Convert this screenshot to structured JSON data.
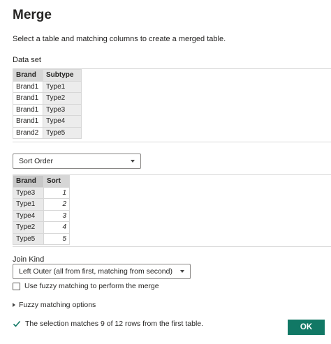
{
  "dialog": {
    "title": "Merge",
    "subtitle": "Select a table and matching columns to create a merged table."
  },
  "dataset": {
    "label": "Data set",
    "headers": [
      "Brand",
      "Subtype"
    ],
    "rows": [
      [
        "Brand1",
        "Type1"
      ],
      [
        "Brand1",
        "Type2"
      ],
      [
        "Brand1",
        "Type3"
      ],
      [
        "Brand1",
        "Type4"
      ],
      [
        "Brand2",
        "Type5"
      ]
    ]
  },
  "second_table": {
    "selected": "Sort Order",
    "headers": [
      "Brand",
      "Sort"
    ],
    "rows": [
      [
        "Type3",
        "1"
      ],
      [
        "Type1",
        "2"
      ],
      [
        "Type4",
        "3"
      ],
      [
        "Type2",
        "4"
      ],
      [
        "Type5",
        "5"
      ]
    ]
  },
  "join": {
    "label": "Join Kind",
    "selected": "Left Outer (all from first, matching from second)"
  },
  "fuzzy": {
    "checkbox_label": "Use fuzzy matching to perform the merge",
    "options_label": "Fuzzy matching options"
  },
  "status": {
    "text": "The selection matches 9 of 12 rows from the first table.",
    "color": "#117865"
  },
  "buttons": {
    "ok": "OK"
  },
  "colors": {
    "primary": "#117865"
  }
}
